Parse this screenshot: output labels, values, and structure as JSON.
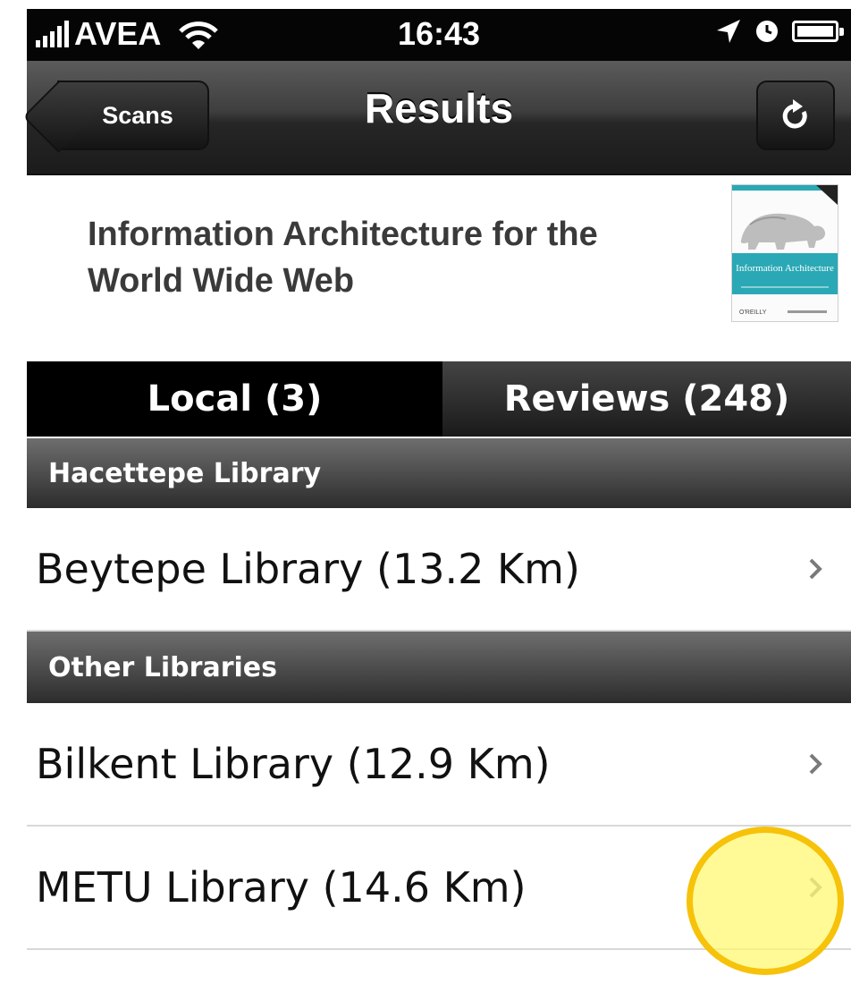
{
  "status_bar": {
    "carrier": "AVEA",
    "time": "16:43",
    "icons": [
      "signal-bars-icon",
      "wifi-icon",
      "location-arrow-icon",
      "alarm-clock-icon",
      "battery-icon"
    ]
  },
  "nav_bar": {
    "back_label": "Scans",
    "title": "Results",
    "refresh_icon": "refresh-icon"
  },
  "book": {
    "title": "Information Architecture for the World Wide Web",
    "cover_text": "Information Architecture",
    "cover_publisher": "O'REILLY"
  },
  "segments": {
    "local_label": "Local (3)",
    "reviews_label": "Reviews (248)",
    "selected": "local"
  },
  "sections": [
    {
      "header": "Hacettepe Library",
      "items": [
        {
          "label": "Beytepe Library (13.2 Km)"
        }
      ]
    },
    {
      "header": "Other Libraries",
      "items": [
        {
          "label": "Bilkent Library (12.9 Km)"
        },
        {
          "label": "METU Library (14.6 Km)"
        }
      ]
    }
  ],
  "colors": {
    "status_bar_bg": "#050505",
    "nav_bar_bg": "#3e3e3e",
    "segment_selected_bg": "#000000",
    "section_header_bg": "#4a4a4a",
    "highlight_ring": "#f6c20a",
    "highlight_fill": "#fff86e"
  }
}
